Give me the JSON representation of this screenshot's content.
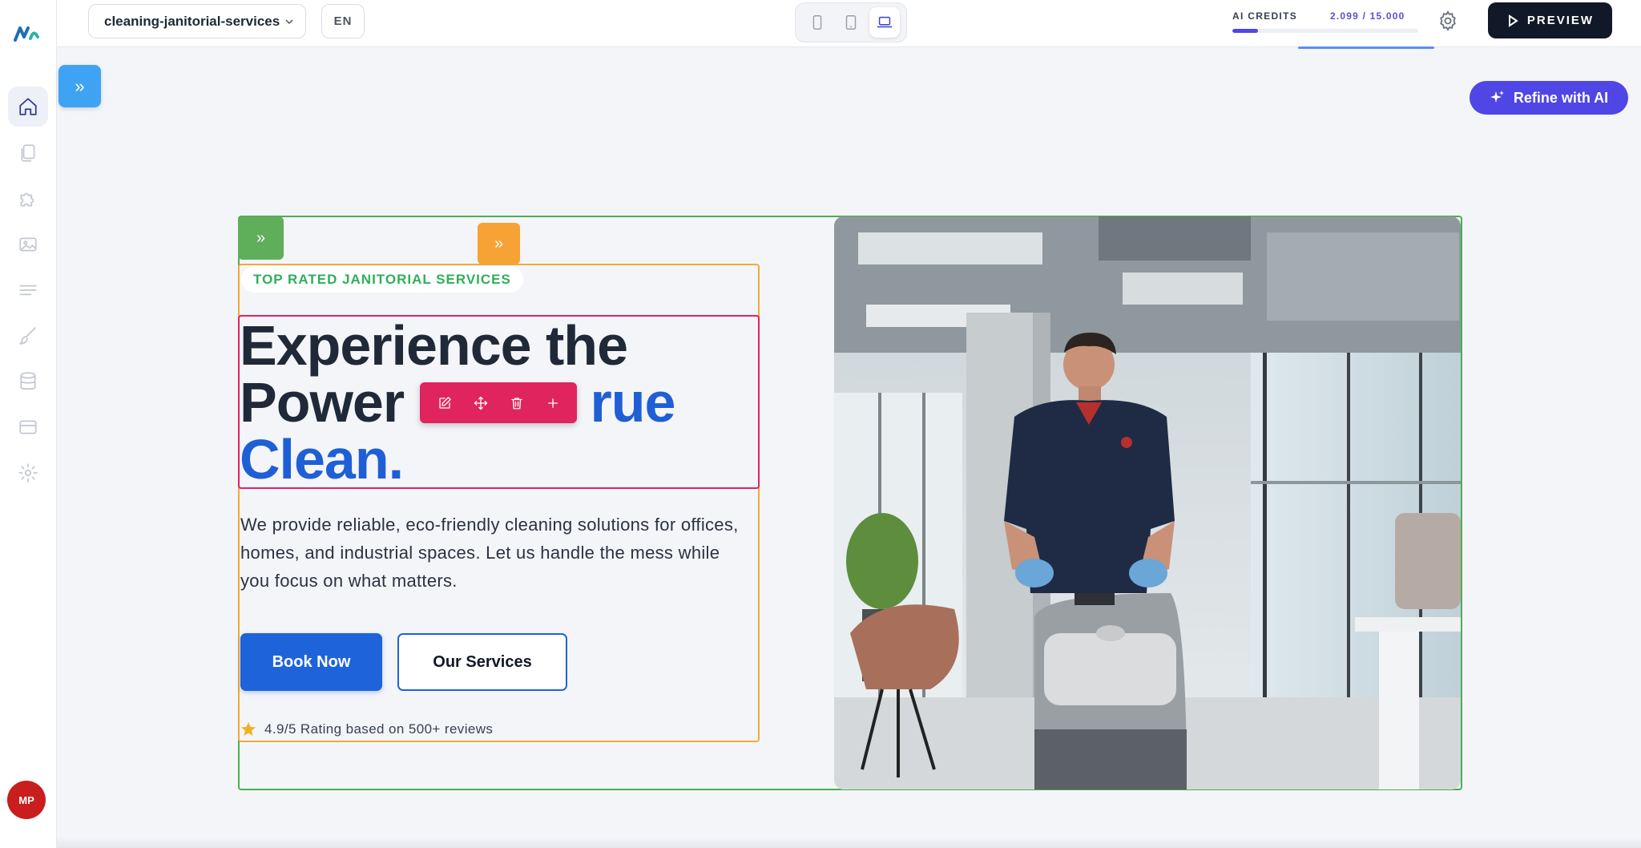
{
  "app": {
    "site_name": "cleaning-janitorial-services",
    "language": "EN",
    "ai_credits_label": "AI CREDITS",
    "ai_credits_value": "2.099 / 15.000",
    "ai_credits_fraction": 0.14,
    "preview_label": "PREVIEW",
    "refine_label": "Refine with AI",
    "avatar_initials": "MP"
  },
  "sidebar": {
    "items": [
      {
        "icon": "home-icon",
        "active": true
      },
      {
        "icon": "pages-icon"
      },
      {
        "icon": "puzzle-icon"
      },
      {
        "icon": "image-icon"
      },
      {
        "icon": "menu-lines-icon"
      },
      {
        "icon": "brush-icon"
      },
      {
        "icon": "database-icon"
      },
      {
        "icon": "card-icon"
      },
      {
        "icon": "gear-icon"
      }
    ]
  },
  "devices": [
    {
      "icon": "phone-icon"
    },
    {
      "icon": "tablet-icon"
    },
    {
      "icon": "laptop-icon",
      "active": true
    }
  ],
  "hero": {
    "badge": "TOP RATED JANITORIAL SERVICES",
    "heading_line1": "Experience the",
    "heading_line2a": "Power ",
    "heading_line2b": "rue",
    "heading_line3": "Clean.",
    "paragraph": "We provide reliable, eco-friendly cleaning solutions for offices, homes, and industrial spaces. Let us handle the mess while you focus on what matters.",
    "primary_button": "Book Now",
    "secondary_button": "Our Services",
    "rating_text": "4.9/5 Rating based on 500+ reviews"
  },
  "colors": {
    "accent": "#4f46e5",
    "section_outline": "#4caf50",
    "content_outline": "#f0a93b",
    "heading_outline": "#e0245e",
    "primary_blue": "#1f63db",
    "badge_green": "#2fae5b"
  }
}
